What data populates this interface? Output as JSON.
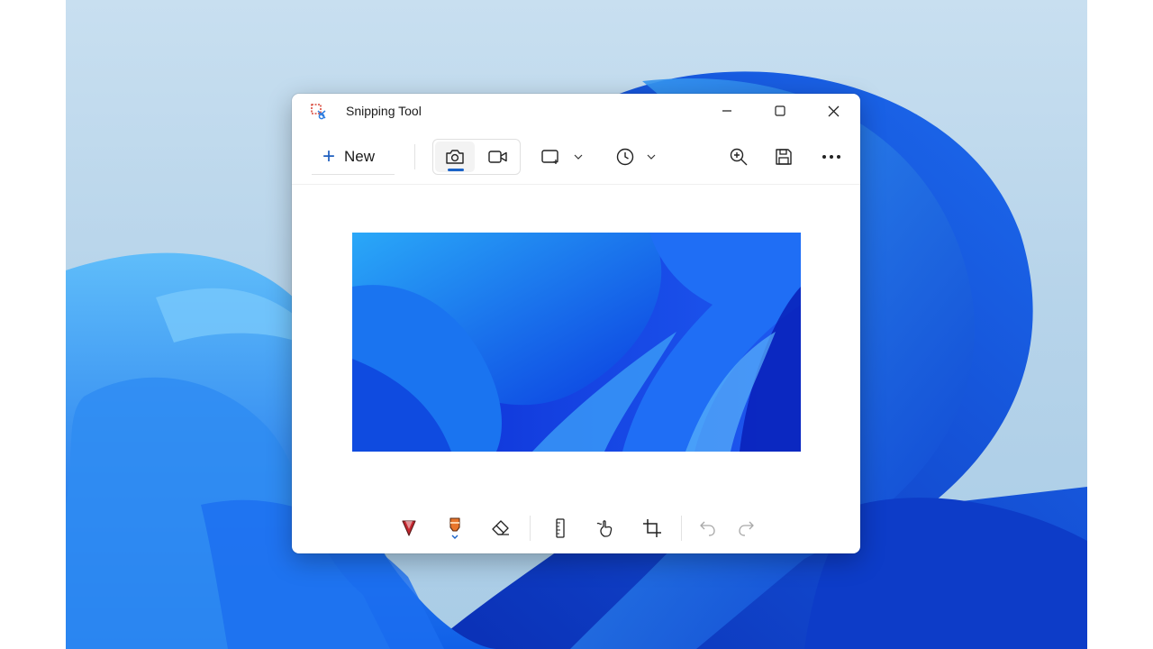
{
  "window": {
    "title": "Snipping Tool"
  },
  "toolbar": {
    "new_label": "New",
    "new_icon": "plus-icon",
    "modes": [
      "camera-icon",
      "video-camera-icon"
    ],
    "selected_mode": "screenshot",
    "snip_shape_icon": "rectangle-snip-icon",
    "delay_icon": "clock-icon",
    "right_icons": [
      "zoom-in-icon",
      "save-icon",
      "more-icon"
    ]
  },
  "annotation_toolbar": {
    "tools": [
      "ballpoint-pen-icon",
      "highlighter-icon",
      "eraser-icon",
      "ruler-icon",
      "touch-writing-icon",
      "crop-icon",
      "undo-icon",
      "redo-icon"
    ],
    "disabled": [
      "undo-icon",
      "redo-icon"
    ]
  },
  "colors": {
    "accent": "#1a63c8",
    "pen": "#c4262e",
    "highlighter": "#e8762c"
  }
}
